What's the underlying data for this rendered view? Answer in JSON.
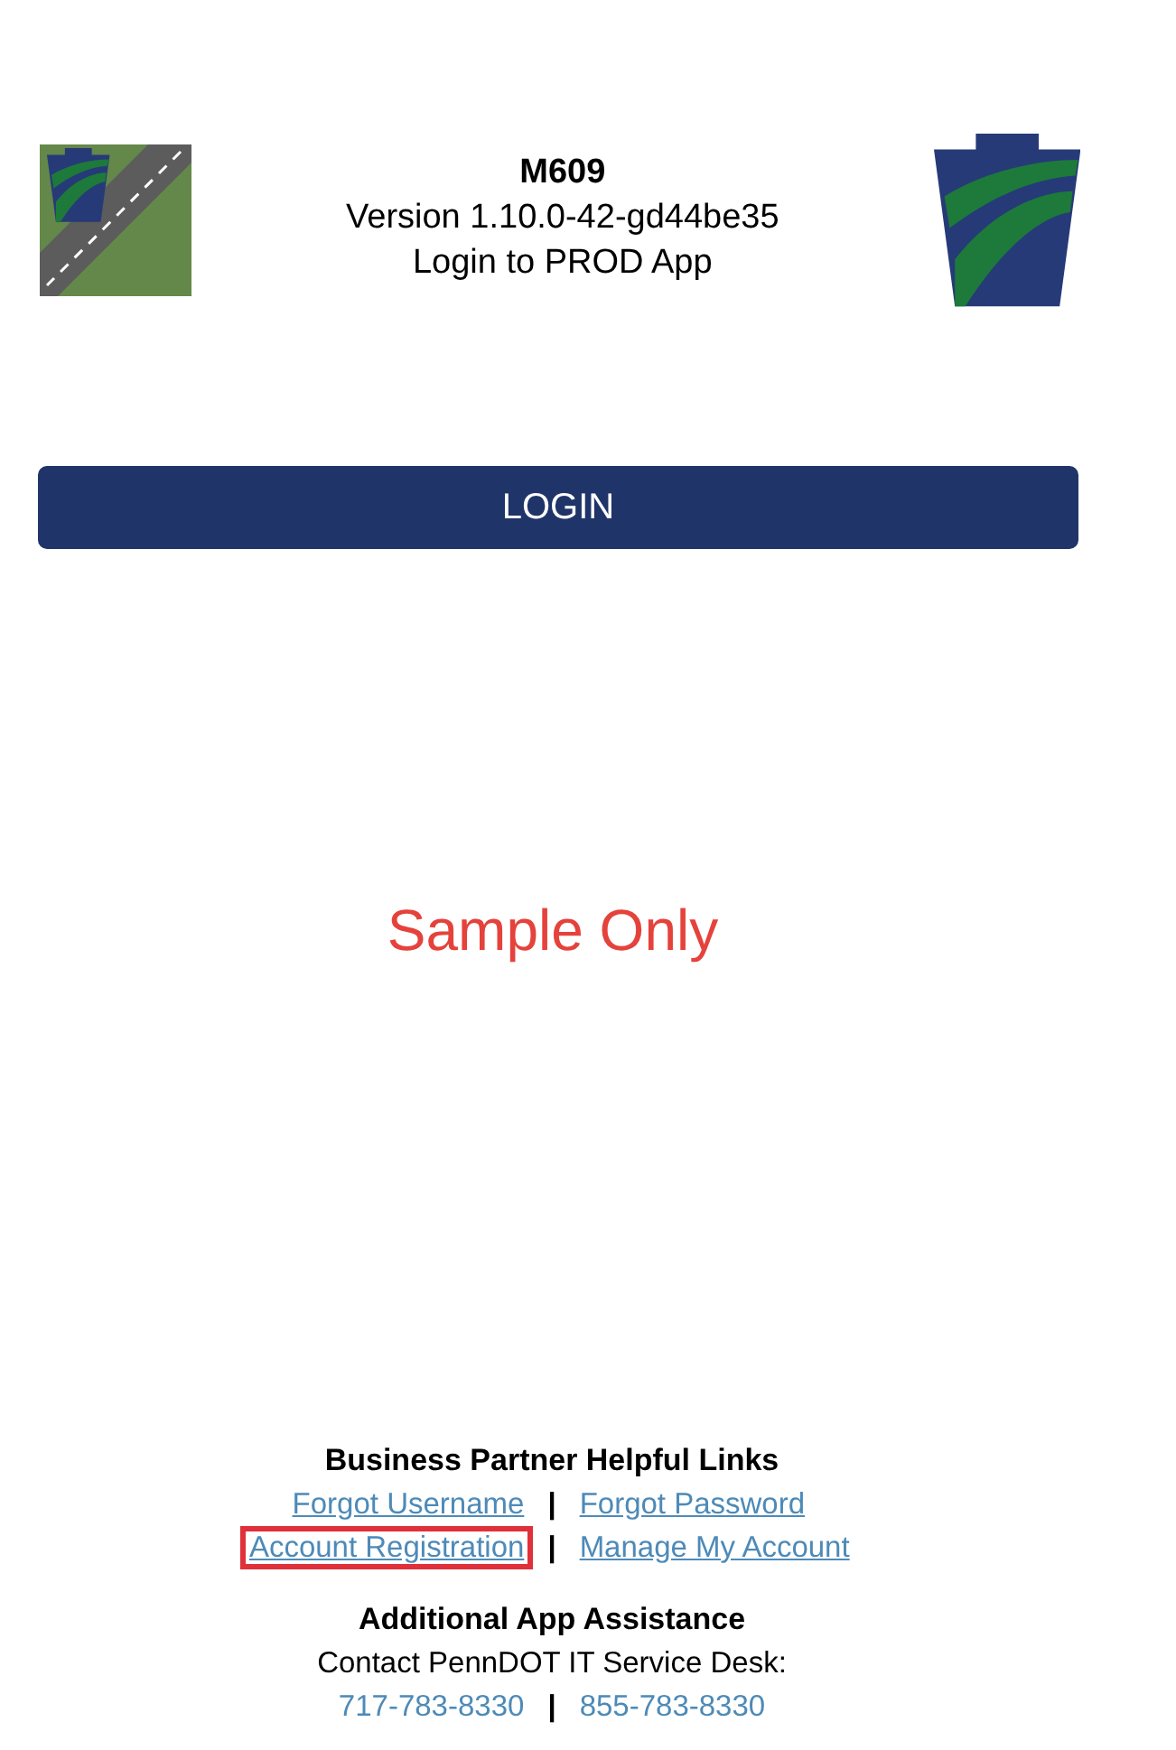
{
  "header": {
    "title": "M609",
    "version": "Version 1.10.0-42-gd44be35",
    "subtitle": "Login to PROD App"
  },
  "login_button": {
    "label": "LOGIN"
  },
  "sample_note": "Sample Only",
  "helpful_links": {
    "heading": "Business Partner Helpful Links",
    "rows": [
      {
        "links": [
          {
            "label": "Forgot Username",
            "highlighted": false
          },
          {
            "label": "Forgot Password",
            "highlighted": false
          }
        ],
        "separator": "|"
      },
      {
        "links": [
          {
            "label": "Account Registration",
            "highlighted": true
          },
          {
            "label": "Manage My Account",
            "highlighted": false
          }
        ],
        "separator": "|"
      }
    ]
  },
  "assistance": {
    "heading": "Additional App Assistance",
    "contact": "Contact PennDOT IT Service Desk:",
    "phones": [
      {
        "label": "717-783-8330"
      },
      {
        "label": "855-783-8330"
      }
    ],
    "separator": "|"
  }
}
